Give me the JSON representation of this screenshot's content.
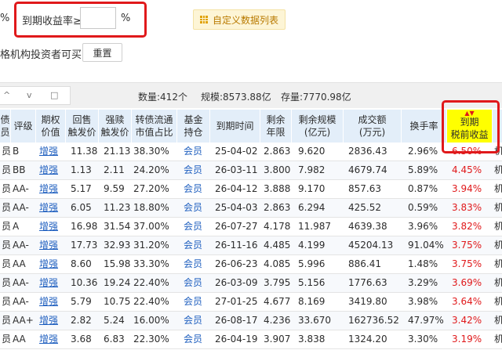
{
  "filter": {
    "pct_left": "%",
    "yield_label": "到期收益率≥",
    "yield_value": "",
    "pct_right": "%",
    "investor_label": "格机构投资者可买",
    "reset_label": "重置",
    "custom_list_label": "自定义数据列表"
  },
  "summary": {
    "count": "数量:412个",
    "scale": "规模:8573.88亿",
    "stock": "存量:7770.98亿",
    "up_icon": "^",
    "down_icon": "v",
    "expand_icon": "□"
  },
  "table": {
    "headers": [
      {
        "l1": "债",
        "l2": "员"
      },
      {
        "l1": "评级",
        "l2": ""
      },
      {
        "l1": "期权",
        "l2": "价值"
      },
      {
        "l1": "回售",
        "l2": "触发价"
      },
      {
        "l1": "强赎",
        "l2": "触发价"
      },
      {
        "l1": "转债流通",
        "l2": "市值占比"
      },
      {
        "l1": "基金",
        "l2": "持仓"
      },
      {
        "l1": "到期时间",
        "l2": ""
      },
      {
        "l1": "剩余",
        "l2": "年限"
      },
      {
        "l1": "剩余规模",
        "l2": "(亿元)"
      },
      {
        "l1": "成交额",
        "l2": "(万元)"
      },
      {
        "l1": "换手率",
        "l2": ""
      },
      {
        "l1": "到期",
        "l2": "税前收益"
      }
    ],
    "sort_arrow": "▲▼",
    "rows": [
      {
        "c0": "员",
        "rating": "B",
        "option": "增强",
        "putback": "11.38",
        "redeem": "21.13",
        "ratio": "38.30%",
        "fund": "会员",
        "maturity": "25-04-02",
        "years": "2.863",
        "remain": "9.620",
        "turnover_amt": "2836.43",
        "turnover_rate": "2.96%",
        "ytm": "6.50%",
        "edge": "机"
      },
      {
        "c0": "员",
        "rating": "BB",
        "option": "增强",
        "putback": "1.13",
        "redeem": "2.11",
        "ratio": "24.20%",
        "fund": "会员",
        "maturity": "26-03-11",
        "years": "3.800",
        "remain": "7.982",
        "turnover_amt": "4679.74",
        "turnover_rate": "5.89%",
        "ytm": "4.45%",
        "edge": "机"
      },
      {
        "c0": "员",
        "rating": "AA-",
        "option": "增强",
        "putback": "5.17",
        "redeem": "9.59",
        "ratio": "27.20%",
        "fund": "会员",
        "maturity": "26-04-12",
        "years": "3.888",
        "remain": "9.170",
        "turnover_amt": "857.63",
        "turnover_rate": "0.87%",
        "ytm": "3.94%",
        "edge": "机"
      },
      {
        "c0": "员",
        "rating": "AA-",
        "option": "增强",
        "putback": "6.05",
        "redeem": "11.23",
        "ratio": "18.80%",
        "fund": "会员",
        "maturity": "25-04-03",
        "years": "2.863",
        "remain": "6.294",
        "turnover_amt": "425.52",
        "turnover_rate": "0.59%",
        "ytm": "3.83%",
        "edge": "机"
      },
      {
        "c0": "员",
        "rating": "A",
        "option": "增强",
        "putback": "16.98",
        "redeem": "31.54",
        "ratio": "37.00%",
        "fund": "会员",
        "maturity": "26-07-27",
        "years": "4.178",
        "remain": "11.987",
        "turnover_amt": "4639.38",
        "turnover_rate": "3.96%",
        "ytm": "3.82%",
        "edge": "机"
      },
      {
        "c0": "员",
        "rating": "AA-",
        "option": "增强",
        "putback": "17.73",
        "redeem": "32.93",
        "ratio": "31.20%",
        "fund": "会员",
        "maturity": "26-11-16",
        "years": "4.485",
        "remain": "4.199",
        "turnover_amt": "45204.13",
        "turnover_rate": "91.04%",
        "ytm": "3.75%",
        "edge": "机"
      },
      {
        "c0": "员",
        "rating": "AA",
        "option": "增强",
        "putback": "8.60",
        "redeem": "15.98",
        "ratio": "33.30%",
        "fund": "会员",
        "maturity": "26-06-23",
        "years": "4.085",
        "remain": "5.996",
        "turnover_amt": "886.41",
        "turnover_rate": "1.48%",
        "ytm": "3.75%",
        "edge": "机"
      },
      {
        "c0": "员",
        "rating": "AA-",
        "option": "增强",
        "putback": "10.36",
        "redeem": "19.24",
        "ratio": "22.40%",
        "fund": "会员",
        "maturity": "26-03-09",
        "years": "3.795",
        "remain": "5.156",
        "turnover_amt": "1776.63",
        "turnover_rate": "3.29%",
        "ytm": "3.69%",
        "edge": "机"
      },
      {
        "c0": "员",
        "rating": "AA-",
        "option": "增强",
        "putback": "5.79",
        "redeem": "10.75",
        "ratio": "22.40%",
        "fund": "会员",
        "maturity": "27-01-25",
        "years": "4.677",
        "remain": "8.169",
        "turnover_amt": "3419.80",
        "turnover_rate": "3.98%",
        "ytm": "3.64%",
        "edge": "机"
      },
      {
        "c0": "员",
        "rating": "AA+",
        "option": "增强",
        "putback": "2.82",
        "redeem": "5.24",
        "ratio": "16.00%",
        "fund": "会员",
        "maturity": "26-08-17",
        "years": "4.236",
        "remain": "33.670",
        "turnover_amt": "162736.52",
        "turnover_rate": "47.97%",
        "ytm": "3.42%",
        "edge": "机"
      },
      {
        "c0": "员",
        "rating": "AA",
        "option": "增强",
        "putback": "3.68",
        "redeem": "6.83",
        "ratio": "22.30%",
        "fund": "会员",
        "maturity": "26-04-19",
        "years": "3.907",
        "remain": "3.838",
        "turnover_amt": "1324.20",
        "turnover_rate": "3.30%",
        "ytm": "3.19%",
        "edge": "机"
      }
    ]
  }
}
